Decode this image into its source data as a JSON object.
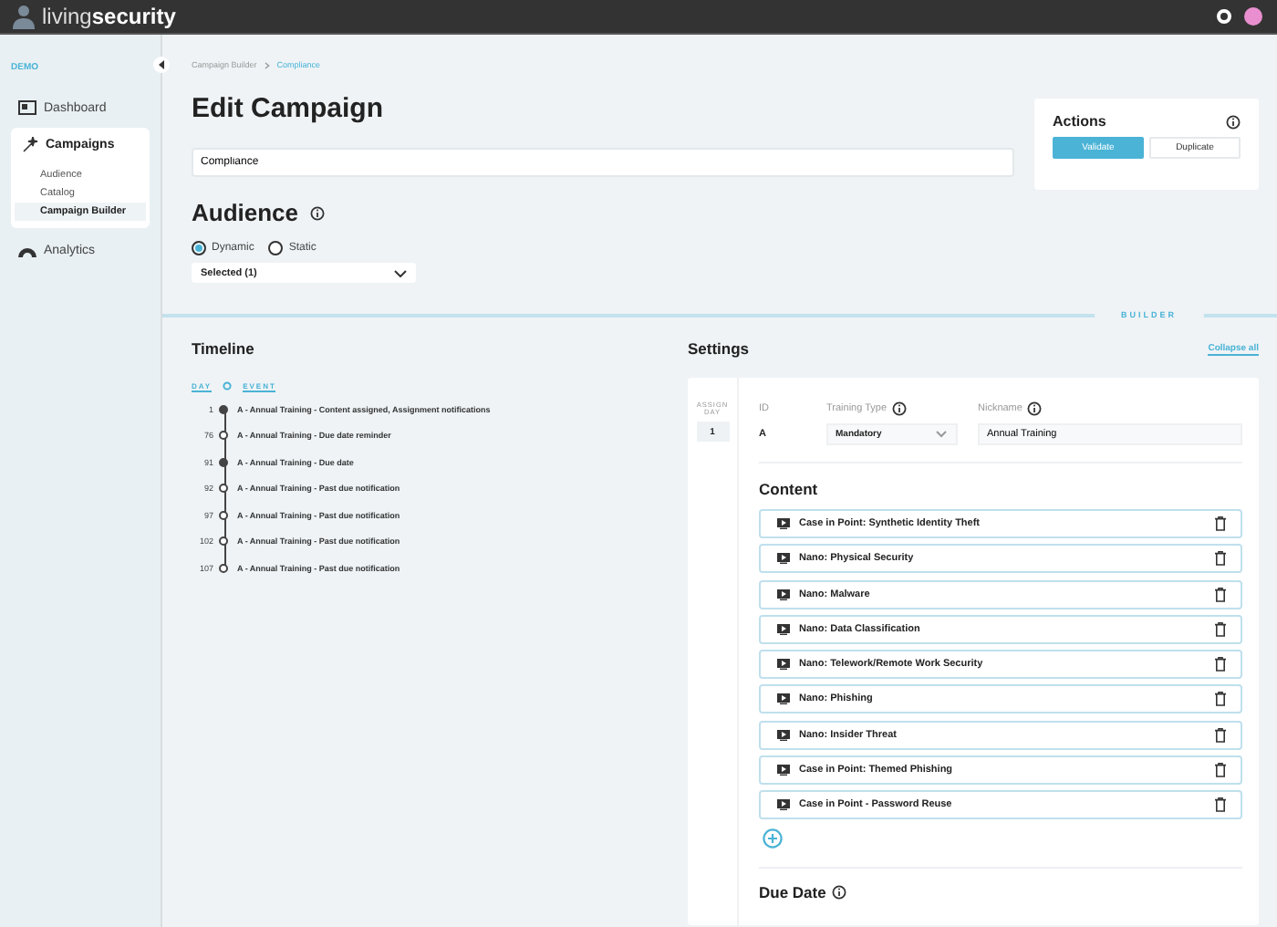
{
  "brand": {
    "light": "living",
    "bold": "security"
  },
  "sidebar": {
    "env": "DEMO",
    "items": [
      {
        "label": "Dashboard",
        "selected": false,
        "expanded": false
      },
      {
        "label": "Campaigns",
        "selected": true,
        "expanded": true,
        "children": [
          {
            "label": "Audience",
            "selected": false
          },
          {
            "label": "Catalog",
            "selected": false
          },
          {
            "label": "Campaign Builder",
            "selected": true
          }
        ]
      },
      {
        "label": "Analytics",
        "selected": false,
        "expanded": false
      }
    ]
  },
  "breadcrumb": [
    "Campaign Builder",
    "Compliance"
  ],
  "title": "Edit Campaign",
  "name_field": {
    "value": "Compliance"
  },
  "actions": {
    "title": "Actions",
    "buttons": [
      {
        "label": "Validate",
        "kind": "primary"
      },
      {
        "label": "Duplicate",
        "kind": "secondary"
      }
    ]
  },
  "audience": {
    "title": "Audience",
    "options": [
      {
        "label": "Dynamic",
        "selected": true
      },
      {
        "label": "Static",
        "selected": false
      }
    ],
    "select": "Selected (1)"
  },
  "divider_tab": "BUILDER",
  "timeline": {
    "title": "Timeline",
    "columns": [
      "DAY",
      "EVENT"
    ],
    "events": [
      {
        "day": "1",
        "text": "A - Annual Training - Content assigned, Assignment notifications",
        "filled": true
      },
      {
        "day": "76",
        "text": "A - Annual Training - Due date reminder",
        "filled": false
      },
      {
        "day": "91",
        "text": "A - Annual Training - Due date",
        "filled": true
      },
      {
        "day": "92",
        "text": "A - Annual Training - Past due notification",
        "filled": false
      },
      {
        "day": "97",
        "text": "A - Annual Training - Past due notification",
        "filled": false
      },
      {
        "day": "102",
        "text": "A - Annual Training - Past due notification",
        "filled": false
      },
      {
        "day": "107",
        "text": "A - Annual Training - Past due notification",
        "filled": false
      }
    ]
  },
  "settings": {
    "title": "Settings",
    "collapse_link": "Collapse all",
    "assign_label": "ASSIGN DAY",
    "assign_day": "1",
    "id_label": "ID",
    "id_value": "A",
    "type_label": "Training Type",
    "type_value": "Mandatory",
    "nickname_label": "Nickname",
    "nickname_value": "Annual Training",
    "content_title": "Content",
    "content": [
      "Case in Point: Synthetic Identity Theft",
      "Nano: Physical Security",
      "Nano: Malware",
      "Nano: Data Classification",
      "Nano: Telework/Remote Work Security",
      "Nano: Phishing",
      "Nano: Insider Threat",
      "Case in Point: Themed Phishing",
      "Case in Point - Password Reuse"
    ],
    "due_title": "Due Date"
  }
}
